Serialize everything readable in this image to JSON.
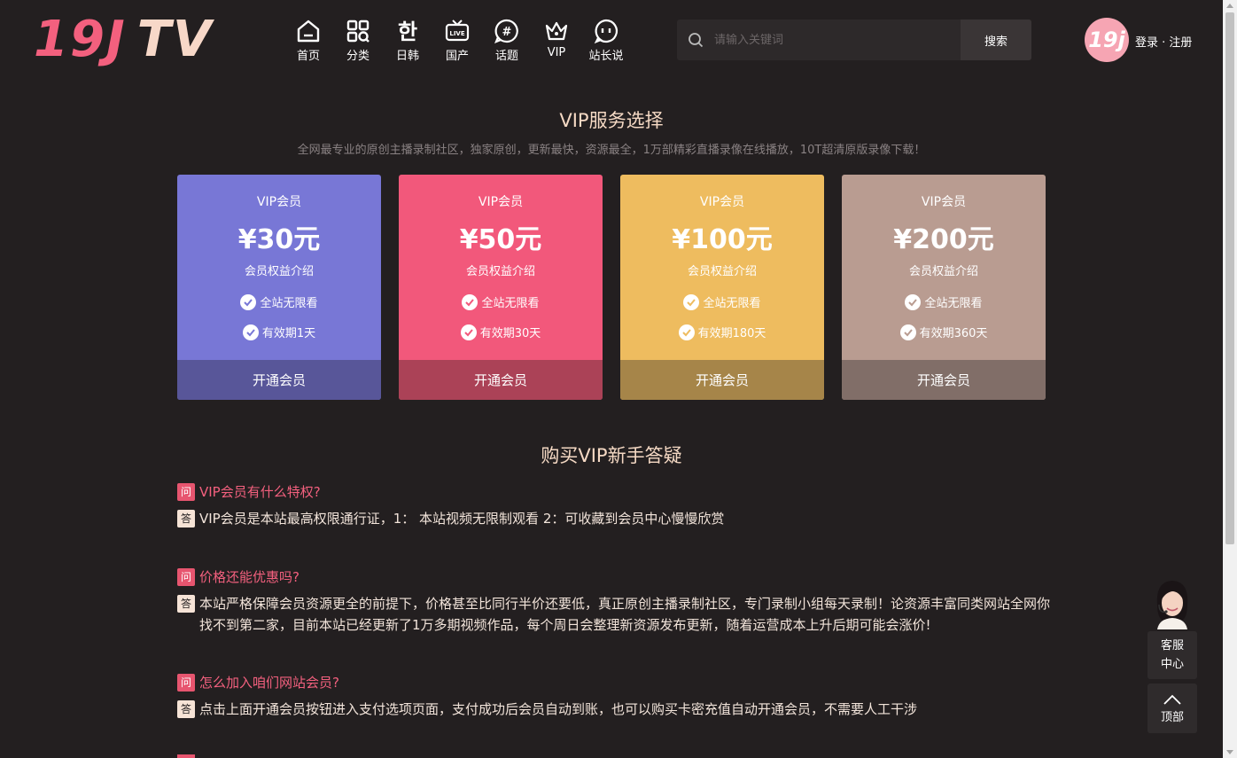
{
  "header": {
    "logo": {
      "part1": "19J",
      "part2": "TV"
    },
    "nav": [
      {
        "label": "首页",
        "icon": "home-icon"
      },
      {
        "label": "分类",
        "icon": "category-icon"
      },
      {
        "label": "日韩",
        "icon": "korean-char-icon",
        "glyph": "한"
      },
      {
        "label": "国产",
        "icon": "live-tv-icon"
      },
      {
        "label": "话题",
        "icon": "hashtag-icon"
      },
      {
        "label": "VIP",
        "icon": "crown-icon"
      },
      {
        "label": "站长说",
        "icon": "chat-face-icon"
      }
    ],
    "search": {
      "placeholder": "请输入关键词",
      "button": "搜索"
    },
    "avatar_text": "19j",
    "login": "登录",
    "separator": " · ",
    "register": "注册"
  },
  "vip_section": {
    "title": "VIP服务选择",
    "subtitle": "全网最专业的原创主播录制社区，独家原创，更新最快，资源最全，1万部精彩直播录像在线播放，10T超清原版录像下载！",
    "plans": [
      {
        "label": "VIP会员",
        "price": "¥30元",
        "desc": "会员权益介绍",
        "feature1": "全站无限看",
        "feature2": "有效期1天",
        "button": "开通会员",
        "color": "#7877d6",
        "btn_color": "#585699"
      },
      {
        "label": "VIP会员",
        "price": "¥50元",
        "desc": "会员权益介绍",
        "feature1": "全站无限看",
        "feature2": "有效期30天",
        "button": "开通会员",
        "color": "#f2587b",
        "btn_color": "#ab4257"
      },
      {
        "label": "VIP会员",
        "price": "¥100元",
        "desc": "会员权益介绍",
        "feature1": "全站无限看",
        "feature2": "有效期180天",
        "button": "开通会员",
        "color": "#eebc5f",
        "btn_color": "#a68549"
      },
      {
        "label": "VIP会员",
        "price": "¥200元",
        "desc": "会员权益介绍",
        "feature1": "全站无限看",
        "feature2": "有效期360天",
        "button": "开通会员",
        "color": "#b99c91",
        "btn_color": "#816e68"
      }
    ]
  },
  "faq_section": {
    "title": "购买VIP新手答疑",
    "q_tag": "问",
    "a_tag": "答",
    "items": [
      {
        "q": "VIP会员有什么特权?",
        "a": "VIP会员是本站最高权限通行证，1： 本站视频无限制观看 2：可收藏到会员中心慢慢欣赏"
      },
      {
        "q": "价格还能优惠吗?",
        "a": "本站严格保障会员资源更全的前提下，价格甚至比同行半价还要低，真正原创主播录制社区，专门录制小组每天录制！论资源丰富同类网站全网你找不到第二家，目前本站已经更新了1万多期视频作品，每个周日会整理新资源发布更新，随着运营成本上升后期可能会涨价!"
      },
      {
        "q": "怎么加入咱们网站会员?",
        "a": "点击上面开通会员按钮进入支付选项页面，支付成功后会员自动到账，也可以购买卡密充值自动开通会员，不需要人工干涉"
      }
    ]
  },
  "side": {
    "service_line1": "客服",
    "service_line2": "中心",
    "top_label": "顶部"
  }
}
